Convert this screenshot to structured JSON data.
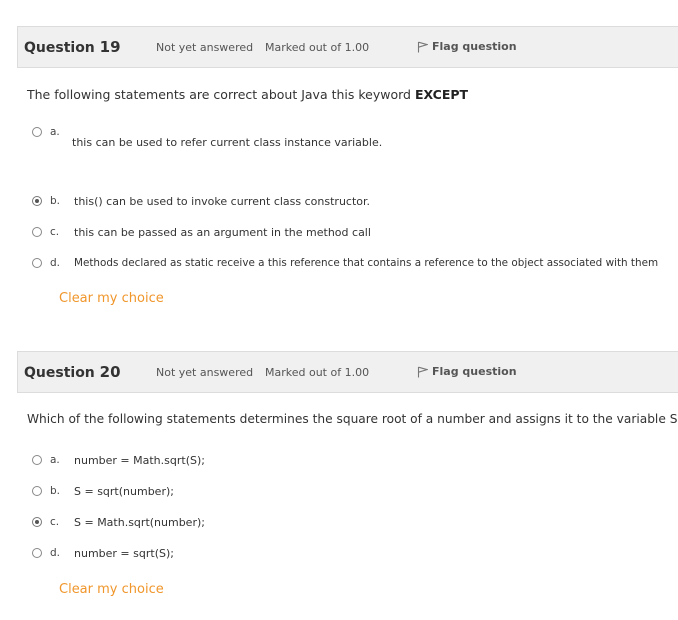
{
  "q19": {
    "label": "Question",
    "number": "19",
    "status": "Not yet answered",
    "marked": "Marked out of 1.00",
    "flag": "Flag question",
    "text_main": "The following statements are correct about Java this keyword ",
    "text_bold": "EXCEPT",
    "options": [
      {
        "letter": "a.",
        "text": "this can be used to refer current class instance variable.",
        "checked": false
      },
      {
        "letter": "b.",
        "text": "this() can be used to invoke current class constructor.",
        "checked": true
      },
      {
        "letter": "c.",
        "text": "this can be passed as an argument in the method call",
        "checked": false
      },
      {
        "letter": "d.",
        "text": "Methods declared as static receive a this reference that contains a reference to the object associated with them",
        "checked": false
      }
    ],
    "clear": "Clear my choice"
  },
  "q20": {
    "label": "Question",
    "number": "20",
    "status": "Not yet answered",
    "marked": "Marked out of 1.00",
    "flag": "Flag question",
    "text": "Which of the following statements determines the square root of a number and assigns it to the variable S?",
    "options": [
      {
        "letter": "a.",
        "text": "number = Math.sqrt(S);",
        "checked": false
      },
      {
        "letter": "b.",
        "text": "S = sqrt(number);",
        "checked": false
      },
      {
        "letter": "c.",
        "text": "S = Math.sqrt(number);",
        "checked": true
      },
      {
        "letter": "d.",
        "text": "number = sqrt(S);",
        "checked": false
      }
    ],
    "clear": "Clear my choice"
  },
  "icons": {
    "flag": "flag-icon",
    "radio": "radio-button"
  },
  "colors": {
    "accent": "#f0962b",
    "header_bg": "#f0f0f0"
  }
}
